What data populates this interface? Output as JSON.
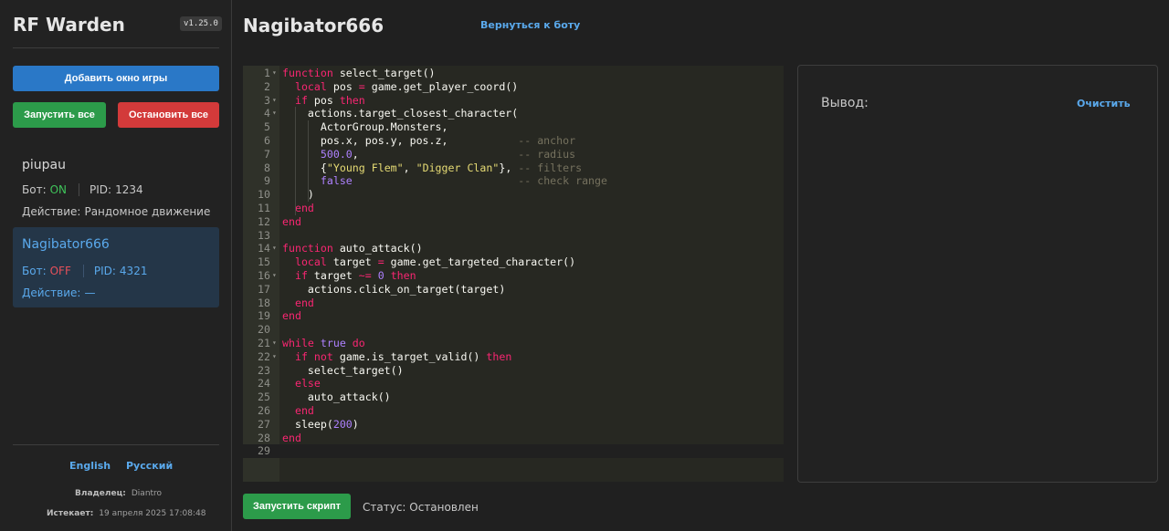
{
  "sidebar": {
    "app_title": "RF Warden",
    "version": "v1.25.0",
    "add_window_label": "Добавить окно игры",
    "start_all_label": "Запустить все",
    "stop_all_label": "Остановить все",
    "clients": [
      {
        "name": "piupau",
        "bot_label": "Бот:",
        "bot_state": "ON",
        "pid_label": "PID:",
        "pid": "1234",
        "action_label": "Действие:",
        "action": "Рандомное движение"
      },
      {
        "name": "Nagibator666",
        "bot_label": "Бот:",
        "bot_state": "OFF",
        "pid_label": "PID:",
        "pid": "4321",
        "action_label": "Действие:",
        "action": "—"
      }
    ],
    "lang_en": "English",
    "lang_ru": "Русский",
    "owner_label": "Владелец:",
    "owner": "Diantro",
    "expires_label": "Истекает:",
    "expires": "19 апреля 2025 17:08:48"
  },
  "main": {
    "title": "Nagibator666",
    "back_link": "Вернуться к боту",
    "output_label": "Вывод:",
    "clear_label": "Очистить",
    "run_label": "Запустить скрипт",
    "status": "Статус: Остановлен"
  },
  "editor": {
    "lines": [
      "function select_target()",
      "  local pos = game.get_player_coord()",
      "  if pos then",
      "    actions.target_closest_character(",
      "      ActorGroup.Monsters,",
      "      pos.x, pos.y, pos.z,           -- anchor",
      "      500.0,                         -- radius",
      "      {\"Young Flem\", \"Digger Clan\"}, -- filters",
      "      false                          -- check range",
      "    )",
      "  end",
      "end",
      "",
      "function auto_attack()",
      "  local target = game.get_targeted_character()",
      "  if target ~= 0 then",
      "    actions.click_on_target(target)",
      "  end",
      "end",
      "",
      "while true do",
      "  if not game.is_target_valid() then",
      "    select_target()",
      "  else",
      "    auto_attack()",
      "  end",
      "  sleep(200)",
      "end",
      ""
    ],
    "fold_lines": [
      1,
      3,
      4,
      14,
      16,
      21,
      22
    ],
    "active_line": 29
  },
  "colors": {
    "accent_blue": "#2a78c7",
    "success_green": "#2c9b4a",
    "danger_red": "#d33a3a",
    "link_blue": "#5aa9ec"
  }
}
